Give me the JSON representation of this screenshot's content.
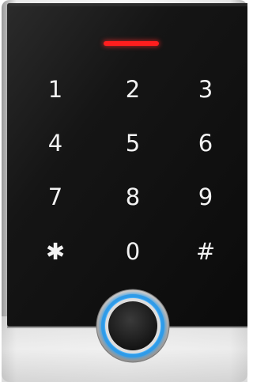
{
  "device": {
    "indicator_color": "#ff1e1e",
    "ring_color": "#2f9be8",
    "keys": [
      {
        "label": "1"
      },
      {
        "label": "2"
      },
      {
        "label": "3"
      },
      {
        "label": "4"
      },
      {
        "label": "5"
      },
      {
        "label": "6"
      },
      {
        "label": "7"
      },
      {
        "label": "8"
      },
      {
        "label": "9"
      },
      {
        "label": "✱"
      },
      {
        "label": "0"
      },
      {
        "label": "#"
      }
    ]
  }
}
